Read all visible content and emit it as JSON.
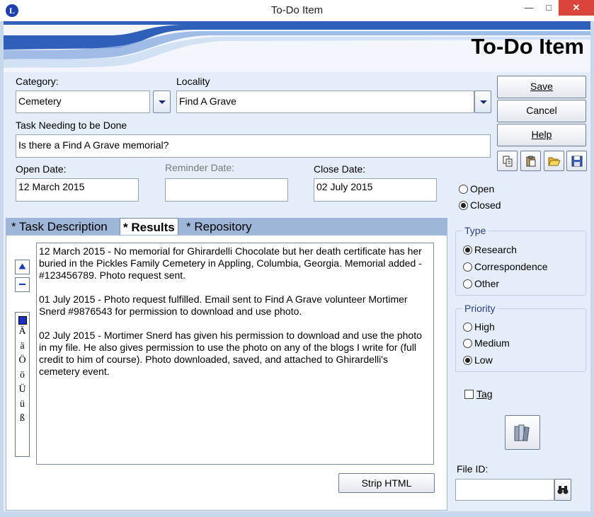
{
  "window": {
    "title": "To-Do Item",
    "logo_letter": "L",
    "minimize": "—",
    "maximize": "□",
    "close": "✕"
  },
  "header": {
    "title": "To-Do Item"
  },
  "fields": {
    "category": {
      "label": "Category:",
      "value": "Cemetery"
    },
    "locality": {
      "label": "Locality",
      "value": "Find A Grave"
    },
    "task": {
      "label": "Task Needing to be Done",
      "value": "Is there a Find A Grave memorial?"
    },
    "open_date": {
      "label": "Open Date:",
      "value": "12 March 2015"
    },
    "reminder_date": {
      "label": "Reminder Date:",
      "value": ""
    },
    "close_date": {
      "label": "Close Date:",
      "value": "02 July 2015"
    }
  },
  "buttons": {
    "save": "Save",
    "cancel": "Cancel",
    "help": "Help",
    "strip_html": "Strip HTML"
  },
  "status": {
    "options": [
      "Open",
      "Closed"
    ],
    "selected": "Closed"
  },
  "type_group": {
    "title": "Type",
    "options": [
      "Research",
      "Correspondence",
      "Other"
    ],
    "selected": "Research"
  },
  "priority_group": {
    "title": "Priority",
    "options": [
      "High",
      "Medium",
      "Low"
    ],
    "selected": "Low"
  },
  "tag": {
    "label": "Tag",
    "checked": false
  },
  "file_id": {
    "label": "File ID:",
    "value": ""
  },
  "tabs": [
    {
      "label": "* Task Description",
      "active": false
    },
    {
      "label": "* Results",
      "active": true
    },
    {
      "label": "* Repository",
      "active": false
    }
  ],
  "results_paragraphs": [
    "12 March 2015 - No memorial for Ghirardelli Chocolate but her death certificate has her buried in the Pickles Family Cemetery in Appling, Columbia, Georgia. Memorial added - #123456789.  Photo request sent.",
    "01 July 2015 - Photo request fulfilled.  Email sent to Find A Grave volunteer Mortimer Snerd #9876543 for permission to download and use photo.",
    "02 July 2015 - Mortimer Snerd has given his permission to download and use the photo in my file.  He also gives permission to use the photo on any of the blogs I write for (full credit to him of course).  Photo downloaded, saved, and attached to Ghirardelli's cemetery event."
  ],
  "char_palette": [
    "Ä",
    "ä",
    "Ö",
    "ö",
    "Ü",
    "ü",
    "ß"
  ],
  "icons": {
    "copy": "copy-icon",
    "paste": "paste-icon",
    "open": "folder-open-icon",
    "save": "floppy-disk-icon",
    "library": "books-icon",
    "find": "binoculars-icon",
    "scroll_up": "arrow-up-icon",
    "scroll_down": "minus-icon",
    "char_color": "color-swatch-icon"
  },
  "colors": {
    "frame": "#c9d7ec",
    "tab_strip": "#9eb6d8",
    "group_title": "#2b3f80",
    "close_button": "#d9453b"
  }
}
